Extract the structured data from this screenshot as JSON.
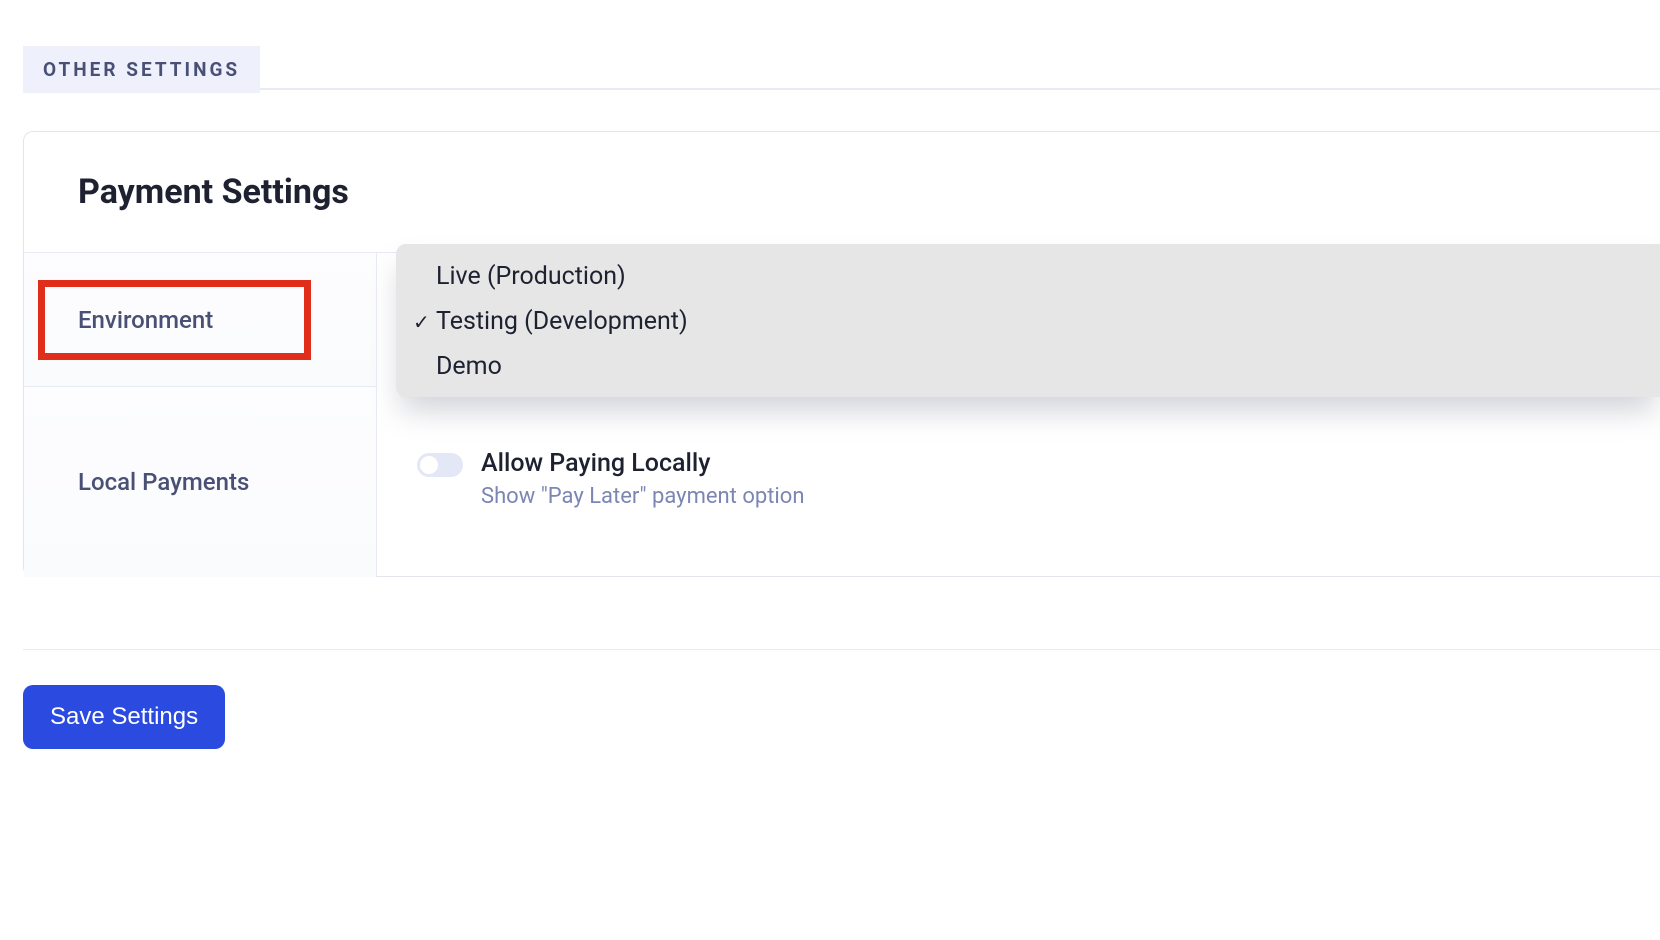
{
  "tab": {
    "other_settings_label": "OTHER SETTINGS"
  },
  "card": {
    "title": "Payment Settings"
  },
  "rows": {
    "environment": {
      "label": "Environment",
      "dropdown": {
        "options": [
          {
            "label": "Live (Production)",
            "selected": false
          },
          {
            "label": "Testing (Development)",
            "selected": true
          },
          {
            "label": "Demo",
            "selected": false
          }
        ]
      }
    },
    "local_payments": {
      "label": "Local Payments",
      "toggle": {
        "title": "Allow Paying Locally",
        "description": "Show \"Pay Later\" payment option",
        "enabled": false
      }
    }
  },
  "footer": {
    "save_label": "Save Settings"
  },
  "icons": {
    "check": "✓"
  }
}
